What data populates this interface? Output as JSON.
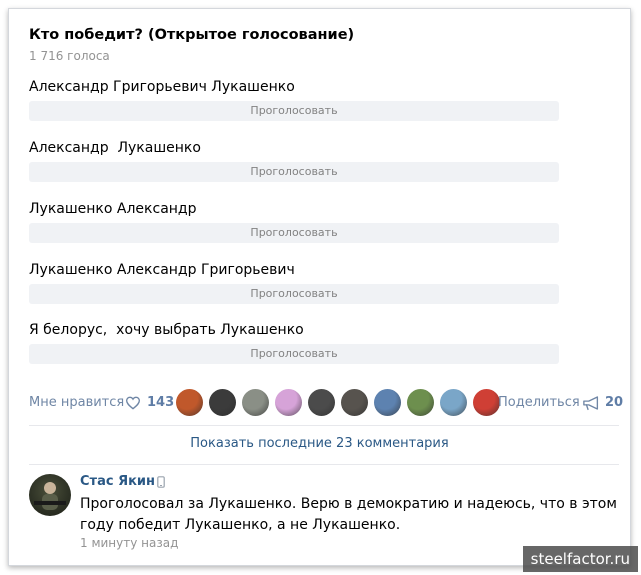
{
  "poll": {
    "title": "Кто победит? (Открытое голосование)",
    "count": "1 716 голоса",
    "vote_label": "Проголосовать",
    "options": [
      "Александр Григорьевич Лукашенко",
      "Александр  Лукашенко",
      "Лукашенко Александр",
      "Лукашенко Александр Григорьевич",
      "Я белорус,  хочу выбрать Лукашенко"
    ]
  },
  "likes": {
    "label": "Мне нравится",
    "count": "143",
    "icon": "heart-icon",
    "avatar_colors": [
      "#c0582b",
      "#3b3b3b",
      "#8a8f86",
      "#d6a3d8",
      "#4b4b4b",
      "#57534e",
      "#5d82b0",
      "#6d8f4e",
      "#7aa6c8",
      "#cf3f35"
    ]
  },
  "share": {
    "label": "Поделиться",
    "count": "20",
    "icon": "megaphone-icon"
  },
  "comments": {
    "show_label": "Показать последние 23 комментария"
  },
  "comment": {
    "author": "Стас Якин",
    "text": "Проголосовал за Лукашенко. Верю в демократию и надеюсь, что в этом году победит Лукашенко,  а не Лукашенко.",
    "time": "1 минуту назад",
    "device_icon": "phone-icon"
  },
  "watermark": "steelfactor.ru",
  "colors": {
    "link": "#2a5885",
    "muted": "#939393",
    "button_bg": "#f0f2f5",
    "like": "#5f7da6"
  }
}
